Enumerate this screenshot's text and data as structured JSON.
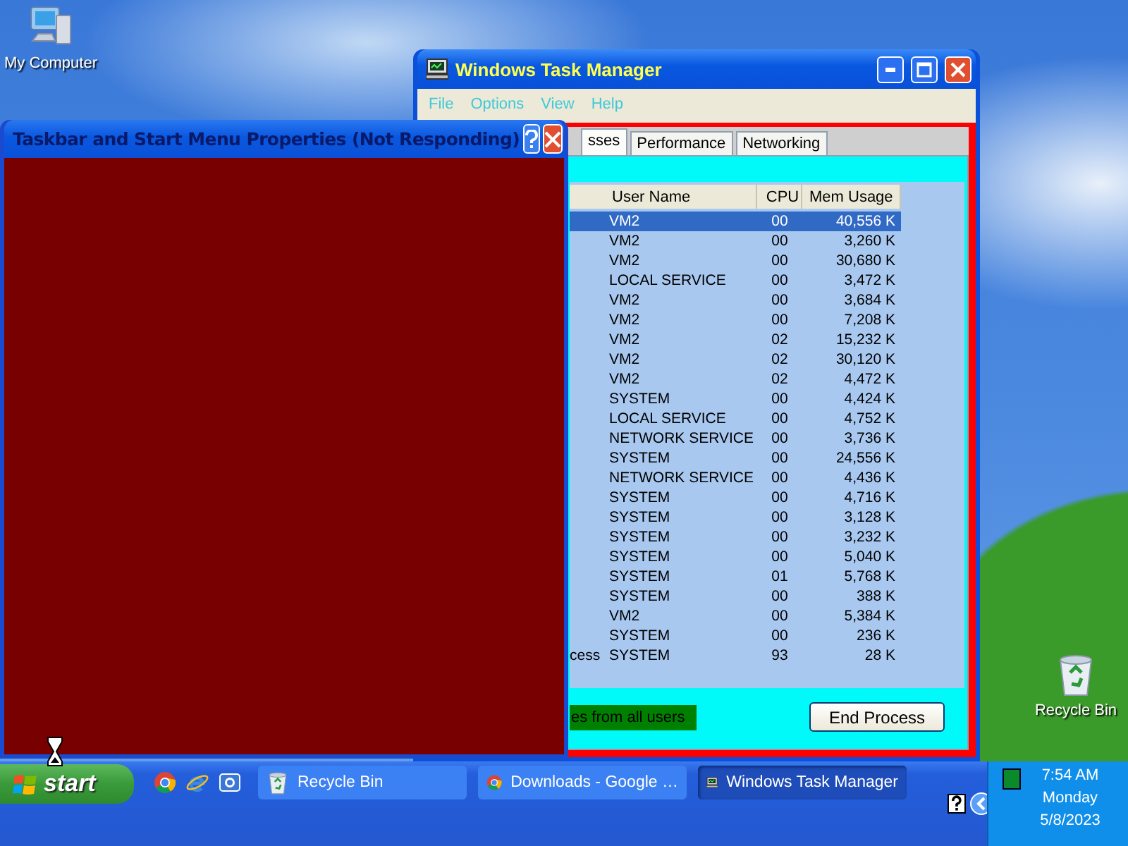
{
  "desktop_icons": [
    {
      "label": "My Computer",
      "kind": "computer"
    },
    {
      "label": "Recycle Bin",
      "kind": "recycle"
    }
  ],
  "task_manager": {
    "title": "Windows Task Manager",
    "menu": [
      "File",
      "Options",
      "View",
      "Help"
    ],
    "tabs": [
      {
        "label": "sses",
        "selected": true
      },
      {
        "label": "Performance",
        "selected": false
      },
      {
        "label": "Networking",
        "selected": false
      }
    ],
    "columns": [
      "User Name",
      "CPU",
      "Mem Usage"
    ],
    "rows": [
      {
        "user": "VM2",
        "cpu": "00",
        "mem": "40,556 K",
        "selected": true
      },
      {
        "user": "VM2",
        "cpu": "00",
        "mem": "3,260 K",
        "selected": false
      },
      {
        "user": "VM2",
        "cpu": "00",
        "mem": "30,680 K",
        "selected": false
      },
      {
        "user": "LOCAL SERVICE",
        "cpu": "00",
        "mem": "3,472 K",
        "selected": false
      },
      {
        "user": "VM2",
        "cpu": "00",
        "mem": "3,684 K",
        "selected": false
      },
      {
        "user": "VM2",
        "cpu": "00",
        "mem": "7,208 K",
        "selected": false
      },
      {
        "user": "VM2",
        "cpu": "02",
        "mem": "15,232 K",
        "selected": false
      },
      {
        "user": "VM2",
        "cpu": "02",
        "mem": "30,120 K",
        "selected": false
      },
      {
        "user": "VM2",
        "cpu": "02",
        "mem": "4,472 K",
        "selected": false
      },
      {
        "user": "SYSTEM",
        "cpu": "00",
        "mem": "4,424 K",
        "selected": false
      },
      {
        "user": "LOCAL SERVICE",
        "cpu": "00",
        "mem": "4,752 K",
        "selected": false
      },
      {
        "user": "NETWORK SERVICE",
        "cpu": "00",
        "mem": "3,736 K",
        "selected": false
      },
      {
        "user": "SYSTEM",
        "cpu": "00",
        "mem": "24,556 K",
        "selected": false
      },
      {
        "user": "NETWORK SERVICE",
        "cpu": "00",
        "mem": "4,436 K",
        "selected": false
      },
      {
        "user": "SYSTEM",
        "cpu": "00",
        "mem": "4,716 K",
        "selected": false
      },
      {
        "user": "SYSTEM",
        "cpu": "00",
        "mem": "3,128 K",
        "selected": false
      },
      {
        "user": "SYSTEM",
        "cpu": "00",
        "mem": "3,232 K",
        "selected": false
      },
      {
        "user": "SYSTEM",
        "cpu": "00",
        "mem": "5,040 K",
        "selected": false
      },
      {
        "user": "SYSTEM",
        "cpu": "01",
        "mem": "5,768 K",
        "selected": false
      },
      {
        "user": "SYSTEM",
        "cpu": "00",
        "mem": "388 K",
        "selected": false
      },
      {
        "user": "VM2",
        "cpu": "00",
        "mem": "5,384 K",
        "selected": false
      },
      {
        "user": "SYSTEM",
        "cpu": "00",
        "mem": "236 K",
        "selected": false
      },
      {
        "image": "cess",
        "user": "SYSTEM",
        "cpu": "93",
        "mem": "28 K",
        "selected": false
      }
    ],
    "checkbox_label": "es from all users",
    "button": "End Process"
  },
  "dialog": {
    "title": "Taskbar and Start Menu Properties (Not Responding)"
  },
  "taskbar": {
    "start": "start",
    "quick_launch": [
      {
        "kind": "chrome"
      },
      {
        "kind": "ie"
      },
      {
        "kind": "outlook"
      }
    ],
    "tasks": [
      {
        "label": "Recycle Bin",
        "kind": "recycle",
        "selected": false
      },
      {
        "label": "Downloads - Google …",
        "kind": "chrome",
        "selected": false
      },
      {
        "label": "Windows Task Manager",
        "kind": "taskmgr",
        "selected": true
      }
    ],
    "clock": {
      "time": "7:54 AM",
      "day": "Monday",
      "date": "5/8/2023"
    }
  }
}
